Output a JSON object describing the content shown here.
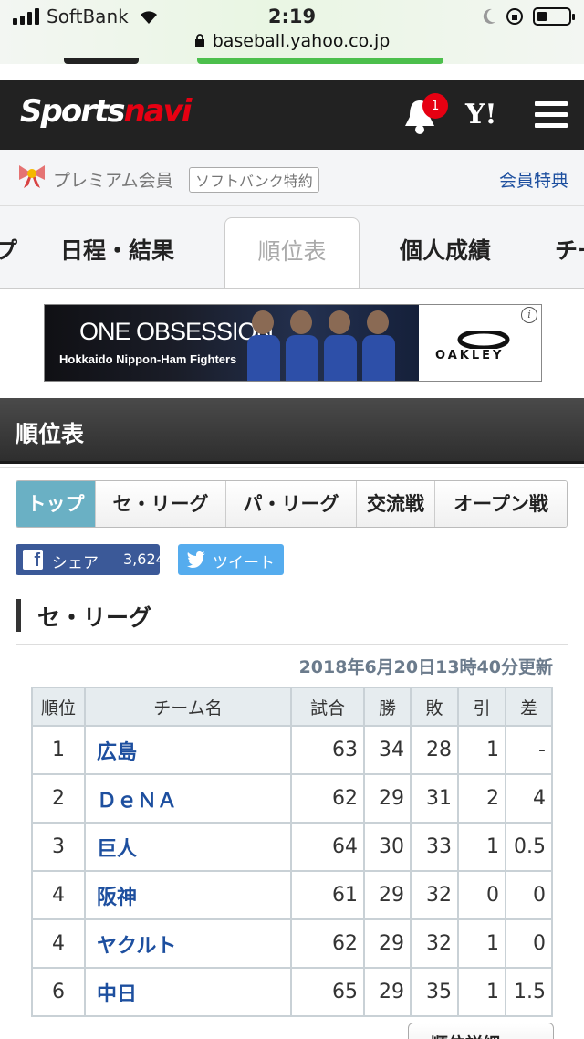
{
  "status": {
    "carrier": "SoftBank",
    "time": "2:19",
    "url": "baseball.yahoo.co.jp"
  },
  "header": {
    "logo_sports": "Sports",
    "logo_navi": "navi",
    "notif_count": "1",
    "yahoo": "Y!"
  },
  "premium": {
    "label": "プレミアム会員",
    "badge": "ソフトバンク特約",
    "link": "会員特典"
  },
  "nav": {
    "tabs": [
      {
        "label": "プ"
      },
      {
        "label": "日程・結果"
      },
      {
        "label": "順位表"
      },
      {
        "label": "個人成績"
      },
      {
        "label": "チー"
      }
    ]
  },
  "ad": {
    "line1": "ONE OBSESSION",
    "line2": "Hokkaido Nippon-Ham Fighters",
    "brand": "OAKLEY"
  },
  "section": {
    "title": "順位表"
  },
  "league_tabs": [
    {
      "label": "トップ"
    },
    {
      "label": "セ・リーグ"
    },
    {
      "label": "パ・リーグ"
    },
    {
      "label": "交流戦"
    },
    {
      "label": "オープン戦"
    }
  ],
  "share": {
    "fb_label": "シェア",
    "fb_count": "3,624",
    "tw_label": "ツイート"
  },
  "league": {
    "title": "セ・リーグ",
    "updated": "2018年6月20日13時40分更新"
  },
  "standings": {
    "headers": [
      "順位",
      "チーム名",
      "試合",
      "勝",
      "敗",
      "引",
      "差"
    ],
    "rows": [
      {
        "rank": "1",
        "team": "広島",
        "games": "63",
        "wins": "34",
        "losses": "28",
        "draws": "1",
        "gb": "-"
      },
      {
        "rank": "2",
        "team": "ＤｅＮＡ",
        "games": "62",
        "wins": "29",
        "losses": "31",
        "draws": "2",
        "gb": "4"
      },
      {
        "rank": "3",
        "team": "巨人",
        "games": "64",
        "wins": "30",
        "losses": "33",
        "draws": "1",
        "gb": "0.5"
      },
      {
        "rank": "4",
        "team": "阪神",
        "games": "61",
        "wins": "29",
        "losses": "32",
        "draws": "0",
        "gb": "0"
      },
      {
        "rank": "4",
        "team": "ヤクルト",
        "games": "62",
        "wins": "29",
        "losses": "32",
        "draws": "1",
        "gb": "0"
      },
      {
        "rank": "6",
        "team": "中日",
        "games": "65",
        "wins": "29",
        "losses": "35",
        "draws": "1",
        "gb": "1.5"
      }
    ]
  },
  "detail_button": "順位詳細"
}
